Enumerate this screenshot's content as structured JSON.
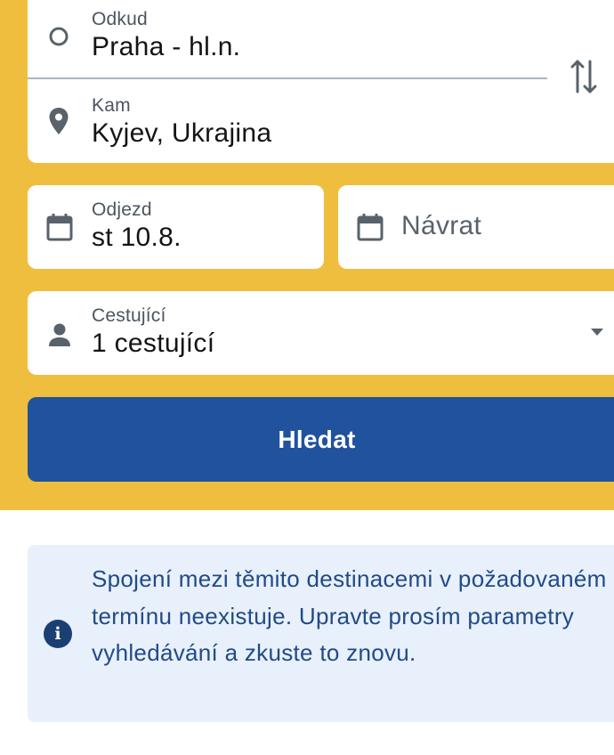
{
  "search_form": {
    "from": {
      "label": "Odkud",
      "value": "Praha - hl.n."
    },
    "to": {
      "label": "Kam",
      "value": "Kyjev, Ukrajina"
    },
    "departure": {
      "label": "Odjezd",
      "value": "st 10.8."
    },
    "return": {
      "placeholder": "Návrat"
    },
    "passengers": {
      "label": "Cestující",
      "value": "1 cestující"
    },
    "search_button": "Hledat"
  },
  "alert": {
    "message": "Spojení mezi těmito destinacemi v požadovaném termínu neexistuje. Upravte prosím parametry vyhledávání a zkuste to znovu."
  },
  "icons": {
    "from": "circle-outline-icon",
    "to": "location-pin-icon",
    "swap": "swap-vertical-icon",
    "departure": "calendar-icon",
    "return": "calendar-icon",
    "passengers": "person-icon",
    "dropdown": "caret-down-icon",
    "info": "info-icon"
  },
  "colors": {
    "header_bg": "#F0BE3E",
    "button_bg": "#21529D",
    "alert_bg": "#E8F0FB",
    "alert_text": "#214B86"
  }
}
